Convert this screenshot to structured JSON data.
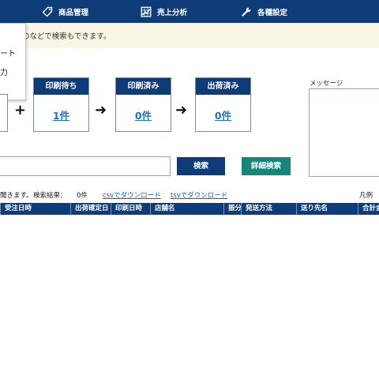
{
  "nav": {
    "items": [
      {
        "label": "商品管理",
        "icon": "tag-icon"
      },
      {
        "label": "売上分析",
        "icon": "chart-icon"
      },
      {
        "label": "各種設定",
        "icon": "wrench-icon"
      }
    ]
  },
  "notice": {
    "text": "のなどで検索もできます。"
  },
  "dropdown": {
    "items": [
      "ート",
      "力"
    ]
  },
  "status": {
    "cards": [
      {
        "title": "印刷待ち",
        "count": "1件"
      },
      {
        "title": "印刷済み",
        "count": "0件"
      },
      {
        "title": "出荷済み",
        "count": "0件"
      }
    ],
    "plus": "+",
    "arrow": "➜"
  },
  "message": {
    "label": "メッセージ"
  },
  "search": {
    "placeholder": "",
    "search_label": "検索",
    "advanced_label": "詳細検索"
  },
  "results": {
    "hint": "聞きます。",
    "count_label": "検索結果：",
    "count": "0件",
    "csv_link": "csvでダウンロード",
    "tsv_link": "tsvでダウンロード",
    "legend": "凡例"
  },
  "table": {
    "headers": [
      "受注日時",
      "出荷確定日",
      "印刷日時",
      "店舗名",
      "振分",
      "発送方法",
      "送り先名",
      "合計金"
    ]
  }
}
